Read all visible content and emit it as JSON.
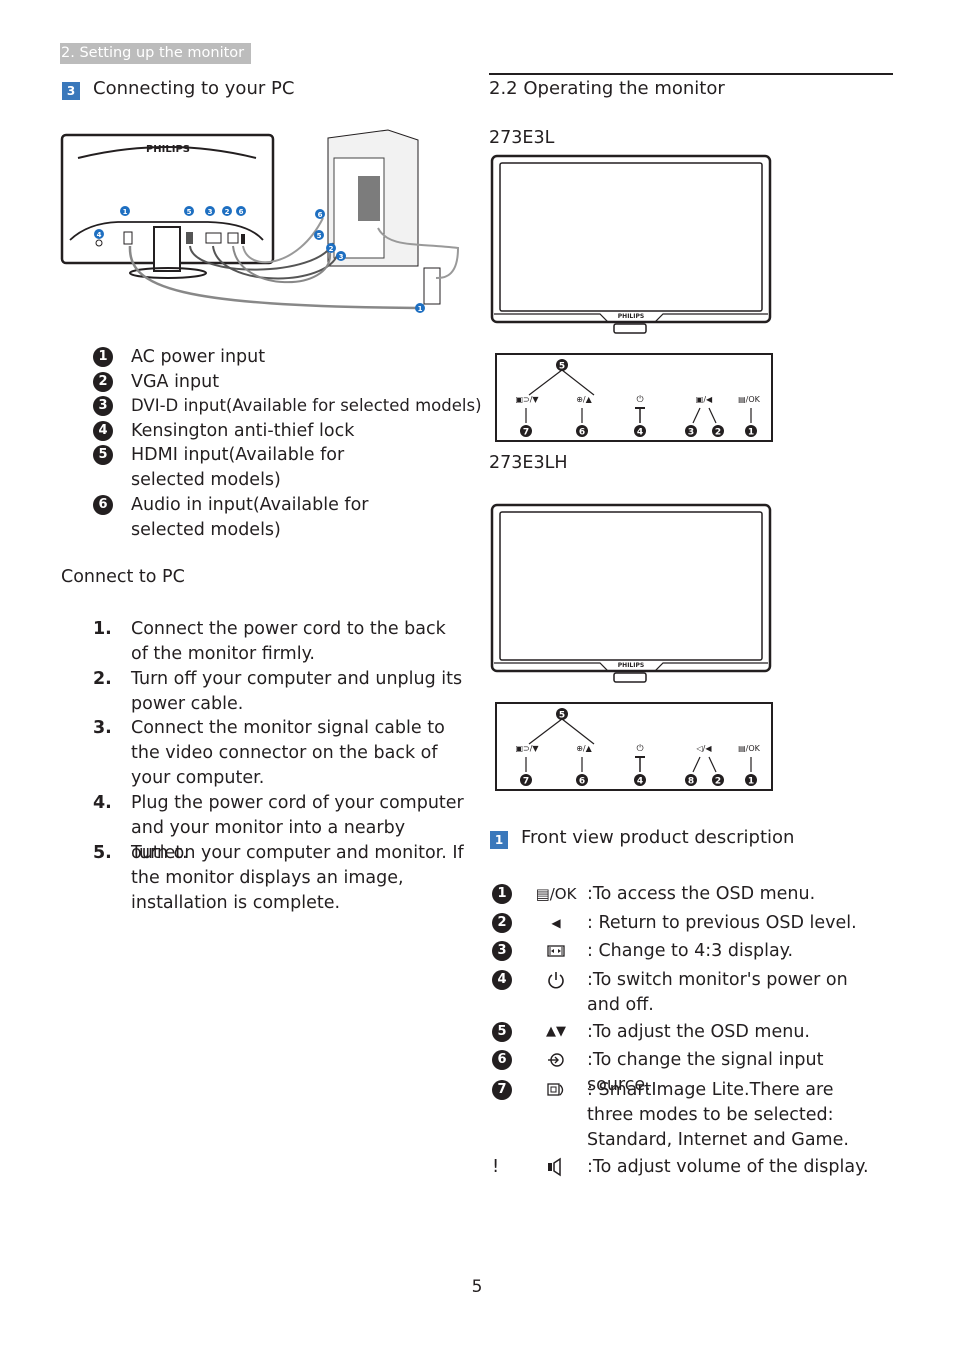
{
  "section_tag": "2. Setting up the monitor",
  "left": {
    "heading": {
      "badge": "3",
      "title": "Connecting to your PC"
    },
    "diagram": {
      "brand": "PHILIPS",
      "callouts": [
        "1",
        "2",
        "3",
        "4",
        "5",
        "6"
      ],
      "badge_color": "#1e6fc1"
    },
    "legend": [
      {
        "num": "1",
        "text": "AC power input"
      },
      {
        "num": "2",
        "text": "VGA input"
      },
      {
        "num": "3",
        "text": "DVI-D input(Available for selected models)"
      },
      {
        "num": "4",
        "text": "Kensington anti-thief lock"
      },
      {
        "num": "5",
        "text": "HDMI input(Available for selected models)"
      },
      {
        "num": "6",
        "text": "Audio in input(Available for selected models)"
      }
    ],
    "connect_title": "Connect to PC",
    "steps": [
      {
        "n": "1.",
        "text": "Connect the power cord to the back of the monitor firmly."
      },
      {
        "n": "2.",
        "text": "Turn off your computer and unplug its power cable."
      },
      {
        "n": "3.",
        "text": "Connect the monitor signal cable to the video connector on the back of your computer."
      },
      {
        "n": "4.",
        "text": "Plug the power cord of your computer and your monitor into a nearby outlet."
      },
      {
        "n": "5.",
        "text": "Turn on your computer and monitor. If the monitor displays an image, installation is complete."
      }
    ]
  },
  "right": {
    "heading": "2.2 Operating the monitor",
    "models": [
      {
        "name": "273E3L",
        "brand": "PHILIPS",
        "buttons": [
          {
            "label": "▣⊃/▼",
            "callout": "7"
          },
          {
            "label": "⊕/▲",
            "callout": "6"
          },
          {
            "label": "⏻",
            "callout": "4"
          },
          {
            "label": "▣/◀",
            "callouts": [
              "3",
              "2"
            ]
          },
          {
            "label": "▤/OK",
            "callout": "1"
          }
        ],
        "top_callout": "5"
      },
      {
        "name": "273E3LH",
        "brand": "PHILIPS",
        "buttons": [
          {
            "label": "▣⊃/▼",
            "callout": "7"
          },
          {
            "label": "⊕/▲",
            "callout": "6"
          },
          {
            "label": "⏻",
            "callout": "4"
          },
          {
            "label": "◁/◀",
            "callouts": [
              "8",
              "2"
            ]
          },
          {
            "label": "▤/OK",
            "callout": "1"
          }
        ],
        "top_callout": "5"
      }
    ],
    "front_view": {
      "badge": "1",
      "title": "Front view product description",
      "items": [
        {
          "num": "1",
          "icon": "menu-ok-icon",
          "symbol": "▤/OK",
          "desc": ":To access the OSD menu."
        },
        {
          "num": "2",
          "icon": "left-arrow-icon",
          "symbol": "◀",
          "desc": ": Return to previous OSD level."
        },
        {
          "num": "3",
          "icon": "aspect-ratio-icon",
          "symbol": "",
          "desc": ": Change to 4:3 display."
        },
        {
          "num": "4",
          "icon": "power-icon",
          "symbol": "⏻",
          "desc": ":To switch monitor's power on and off."
        },
        {
          "num": "5",
          "icon": "up-down-arrows-icon",
          "symbol": "▲▼",
          "desc": ":To adjust the OSD menu."
        },
        {
          "num": "6",
          "icon": "input-source-icon",
          "symbol": "",
          "desc": ":To change the signal input source."
        },
        {
          "num": "7",
          "icon": "smartimage-icon",
          "symbol": "",
          "desc": ": SmartImage Lite.There are three modes to be selected: Standard, Internet and Game."
        },
        {
          "num": "!",
          "icon": "volume-icon",
          "symbol": "",
          "desc": ":To adjust volume of the display."
        }
      ]
    }
  },
  "page_number": "5"
}
